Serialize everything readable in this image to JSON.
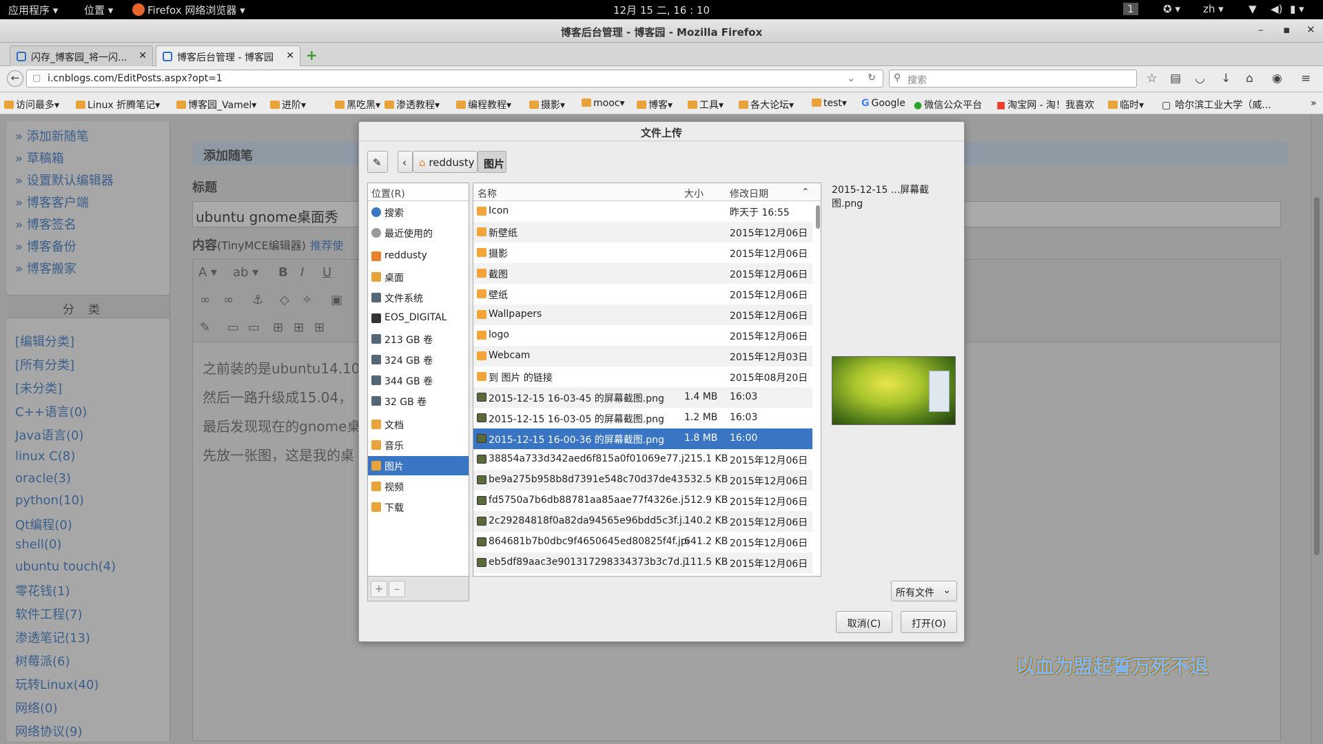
{
  "topbar": {
    "apps": "应用程序 ▾",
    "places": "位置 ▾",
    "browser": "Firefox 网络浏览器 ▾",
    "clock": "12月 15 二, 16 : 10",
    "workspace": "1",
    "lang": "zh ▾"
  },
  "window": {
    "title": "博客后台管理 - 博客园 - Mozilla Firefox"
  },
  "tabs": [
    {
      "label": "闪存_博客园_将一闪..."
    },
    {
      "label": "博客后台管理 - 博客园"
    }
  ],
  "nav": {
    "url": "i.cnblogs.com/EditPosts.aspx?opt=1",
    "search_placeholder": "搜索"
  },
  "bookmarks": [
    "访问最多▾",
    "Linux 折腾笔记▾",
    "博客园_Vamel▾",
    "进阶▾",
    "黑吃黑▾",
    "渗透教程▾",
    "编程教程▾",
    "摄影▾",
    "mooc▾",
    "博客▾",
    "工具▾",
    "各大论坛▾",
    "test▾",
    "Google",
    "微信公众平台",
    "淘宝网 - 淘！我喜欢",
    "临时▾",
    "哈尔滨工业大学（威..."
  ],
  "sidebar": {
    "links": [
      "» 添加新随笔",
      "» 草稿箱",
      "» 设置默认编辑器",
      "» 博客客户端",
      "» 博客签名",
      "» 博客备份",
      "» 博客搬家"
    ],
    "category_title": "分类",
    "categories": [
      "[编辑分类]",
      "[所有分类]",
      "[未分类]",
      "C++语言(0)",
      "Java语言(0)",
      "linux C(8)",
      "oracle(3)",
      "python(10)",
      "Qt编程(0)",
      "shell(0)",
      "ubuntu touch(4)",
      "零花钱(1)",
      "软件工程(7)",
      "渗透笔记(13)",
      "树莓派(6)",
      "玩转Linux(40)",
      "网络(0)",
      "网络协议(9)"
    ]
  },
  "main": {
    "add_title": "添加随笔",
    "title_label": "标题",
    "title_value": "ubuntu gnome桌面秀",
    "content_label": "内容",
    "content_hint": "(TinyMCE编辑器)",
    "content_link": "推荐使",
    "paragraphs": [
      "之前装的是ubuntu14.10",
      "然后一路升级成15.04，",
      "最后发现现在的gnome桌",
      "先放一张图，这是我的桌"
    ]
  },
  "slogan": "以血为盟起誓万死不退",
  "dialog": {
    "title": "文件上传",
    "path": [
      "reddusty",
      "图片"
    ],
    "places_header": "位置(R)",
    "places": [
      {
        "label": "搜索",
        "icon": "search-icon",
        "color": "#3a75c4"
      },
      {
        "label": "最近使用的",
        "icon": "clock-icon",
        "color": "#888888"
      },
      {
        "label": "reddusty",
        "icon": "home-icon",
        "color": "#e8812a"
      },
      {
        "label": "桌面",
        "icon": "desktop-icon",
        "color": "#e8a33a"
      },
      {
        "label": "文件系统",
        "icon": "drive-icon",
        "color": "#556677"
      },
      {
        "label": "EOS_DIGITAL",
        "icon": "sdcard-icon",
        "color": "#333333"
      },
      {
        "label": "213 GB 卷",
        "icon": "drive-icon",
        "color": "#556677"
      },
      {
        "label": "324 GB 卷",
        "icon": "drive-icon",
        "color": "#556677"
      },
      {
        "label": "344 GB 卷",
        "icon": "drive-icon",
        "color": "#556677"
      },
      {
        "label": "32 GB 卷",
        "icon": "drive-icon",
        "color": "#556677"
      },
      {
        "label": "文档",
        "icon": "documents-icon",
        "color": "#e8a33a"
      },
      {
        "label": "音乐",
        "icon": "music-icon",
        "color": "#e8a33a"
      },
      {
        "label": "图片",
        "icon": "pictures-icon",
        "color": "#e8a33a"
      },
      {
        "label": "视频",
        "icon": "video-icon",
        "color": "#e8a33a"
      },
      {
        "label": "下载",
        "icon": "download-icon",
        "color": "#e8a33a"
      }
    ],
    "selected_place": "图片",
    "columns": {
      "name": "名称",
      "size": "大小",
      "date": "修改日期"
    },
    "files": [
      {
        "name": "Icon",
        "size": "",
        "date": "昨天于 16:55",
        "type": "folder"
      },
      {
        "name": "新壁纸",
        "size": "",
        "date": "2015年12月06日",
        "type": "folder"
      },
      {
        "name": "摄影",
        "size": "",
        "date": "2015年12月06日",
        "type": "folder"
      },
      {
        "name": "截图",
        "size": "",
        "date": "2015年12月06日",
        "type": "folder"
      },
      {
        "name": "壁纸",
        "size": "",
        "date": "2015年12月06日",
        "type": "folder"
      },
      {
        "name": "Wallpapers",
        "size": "",
        "date": "2015年12月06日",
        "type": "folder"
      },
      {
        "name": "logo",
        "size": "",
        "date": "2015年12月06日",
        "type": "folder"
      },
      {
        "name": "Webcam",
        "size": "",
        "date": "2015年12月03日",
        "type": "folder"
      },
      {
        "name": "到 图片 的链接",
        "size": "",
        "date": "2015年08月20日",
        "type": "folder"
      },
      {
        "name": "2015-12-15 16-03-45 的屏幕截图.png",
        "size": "1.4 MB",
        "date": "16:03",
        "type": "image"
      },
      {
        "name": "2015-12-15 16-03-05 的屏幕截图.png",
        "size": "1.2 MB",
        "date": "16:03",
        "type": "image"
      },
      {
        "name": "2015-12-15 16-00-36 的屏幕截图.png",
        "size": "1.8 MB",
        "date": "16:00",
        "type": "image",
        "selected": true
      },
      {
        "name": "38854a733d342aed6f815a0f01069e77.j...",
        "size": "215.1 KB",
        "date": "2015年12月06日",
        "type": "image"
      },
      {
        "name": "be9a275b958b8d7391e548c70d37de43...",
        "size": "532.5 KB",
        "date": "2015年12月06日",
        "type": "image"
      },
      {
        "name": "fd5750a7b6db88781aa85aae77f4326e.j...",
        "size": "512.9 KB",
        "date": "2015年12月06日",
        "type": "image"
      },
      {
        "name": "2c29284818f0a82da94565e96bdd5c3f.j...",
        "size": "140.2 KB",
        "date": "2015年12月06日",
        "type": "image"
      },
      {
        "name": "864681b7b0dbc9f4650645ed80825f4f.jpg",
        "size": "641.2 KB",
        "date": "2015年12月06日",
        "type": "image"
      },
      {
        "name": "eb5df89aac3e901317298334373b3c7d.j...",
        "size": "111.5 KB",
        "date": "2015年12月06日",
        "type": "image"
      }
    ],
    "preview_name": "2015-12-15 ...屏幕截图.png",
    "filter": "所有文件",
    "cancel": "取消(C)",
    "open": "打开(O)"
  }
}
